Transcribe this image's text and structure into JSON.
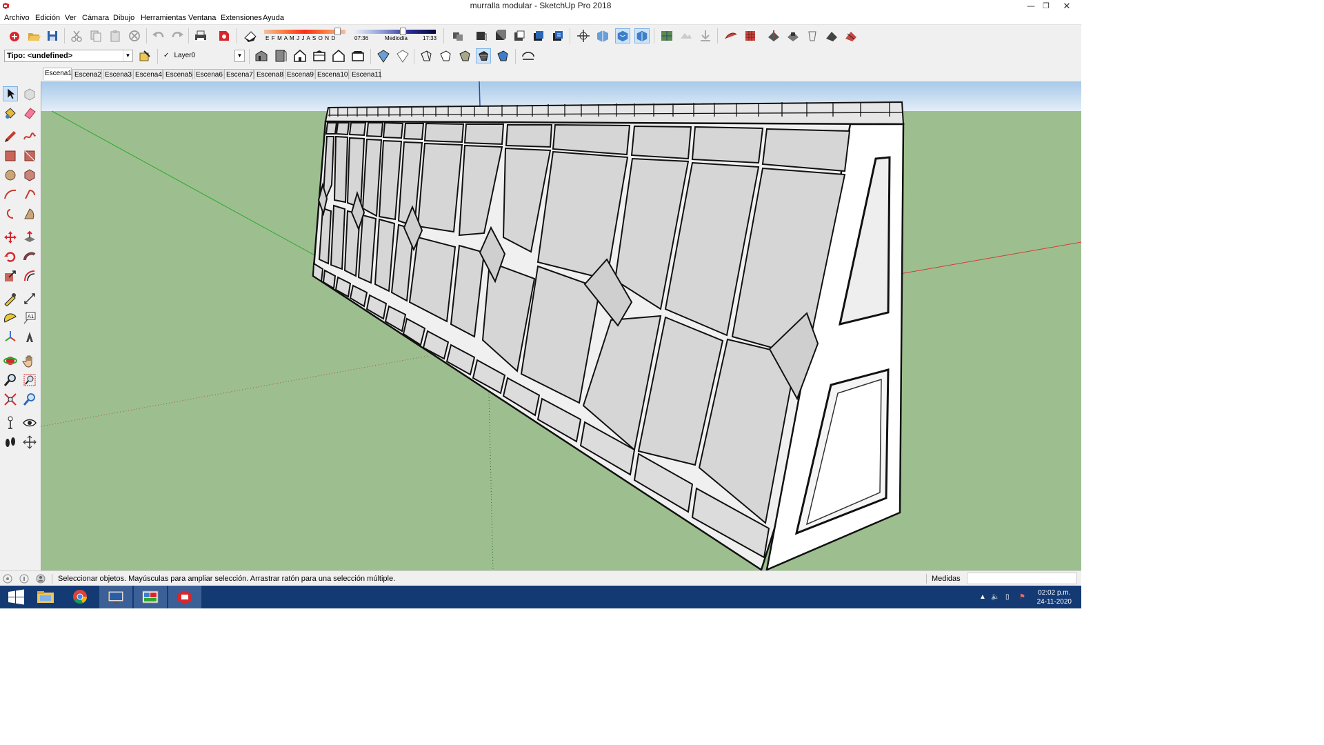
{
  "window": {
    "title": "murralla modular - SketchUp Pro 2018"
  },
  "menu": [
    "Archivo",
    "Edición",
    "Ver",
    "Cámara",
    "Dibujo",
    "Herramientas",
    "Ventana",
    "Extensiones",
    "Ayuda"
  ],
  "shadow": {
    "months": "E F M A M J J A S O N D",
    "time_start": "07:36",
    "time_mid": "Mediodía",
    "time_end": "17:33"
  },
  "toolbar2": {
    "type_value": "Tipo: <undefined>",
    "layer_check": "✓",
    "layer_value": "Layer0"
  },
  "scenes": [
    "Escena1",
    "Escena2",
    "Escena3",
    "Escena4",
    "Escena5",
    "Escena6",
    "Escena7",
    "Escena8",
    "Escena9",
    "Escena10",
    "Escena11"
  ],
  "scene_active": "Escena1",
  "status": {
    "message": "Seleccionar objetos. Mayúsculas para ampliar selección. Arrastrar ratón para una selección múltiple.",
    "measure_label": "Medidas"
  },
  "taskbar": {
    "time": "02:02 p.m.",
    "date": "24-11-2020"
  },
  "colors": {
    "sky_top": "#a7c9e9",
    "ground": "#9dbf8f",
    "panel": "#d6d6d6",
    "wall_end": "#ffffff",
    "taskbar": "#143a74",
    "axis_red": "#d43a3a",
    "axis_green": "#2fa82f"
  }
}
